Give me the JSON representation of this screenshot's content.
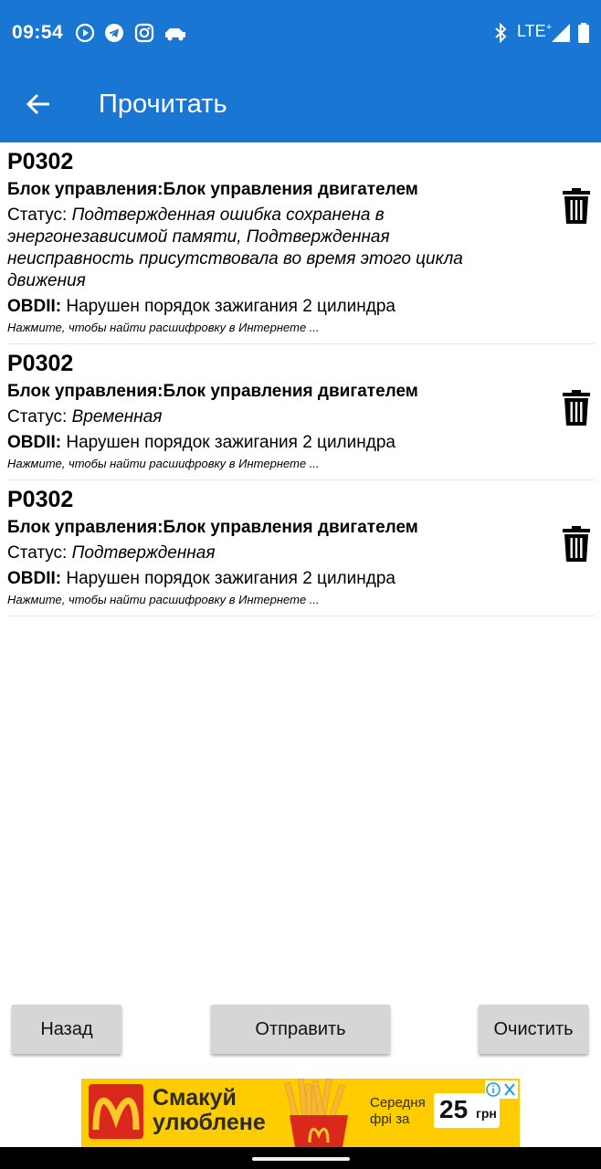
{
  "status_bar": {
    "time": "09:54",
    "network": "LTE",
    "icons": [
      "music-icon",
      "telegram-icon",
      "instagram-icon",
      "car-icon",
      "bluetooth-icon",
      "signal-icon",
      "battery-icon"
    ]
  },
  "app_bar": {
    "title": "Прочитать",
    "back_icon": "arrow-left-icon"
  },
  "errors": [
    {
      "code": "P0302",
      "block": "Блок управления:Блок управления двигателем",
      "status_label": "Статус:",
      "status_value": "Подтвержденная ошибка сохранена в энергонезависимой памяти, Подтвержденная неисправность присутствовала во время этого цикла движения",
      "obd_label": "OBDII:",
      "obd_text": "Нарушен порядок зажигания 2 цилиндра",
      "hint": "Нажмите, чтобы найти расшифровку в Интернете ..."
    },
    {
      "code": "P0302",
      "block": "Блок управления:Блок управления двигателем",
      "status_label": "Статус:",
      "status_value": "Временная",
      "obd_label": "OBDII:",
      "obd_text": "Нарушен порядок зажигания 2 цилиндра",
      "hint": "Нажмите, чтобы найти расшифровку в Интернете ..."
    },
    {
      "code": "P0302",
      "block": "Блок управления:Блок управления двигателем",
      "status_label": "Статус:",
      "status_value": "Подтвержденная",
      "obd_label": "OBDII:",
      "obd_text": "Нарушен порядок зажигания 2 цилиндра",
      "hint": "Нажмите, чтобы найти расшифровку в Интернете ..."
    }
  ],
  "buttons": {
    "back": "Назад",
    "send": "Отправить",
    "clear": "Очистить"
  },
  "ad": {
    "headline_1": "Смакуй",
    "headline_2": "улюблене",
    "sub_1": "Середня",
    "sub_2": "фрі за",
    "price": "25",
    "currency": "грн"
  },
  "colors": {
    "primary": "#1976d2",
    "button_bg": "#d6d6d6",
    "ad_yellow": "#ffcc00",
    "ad_red": "#da291c"
  }
}
